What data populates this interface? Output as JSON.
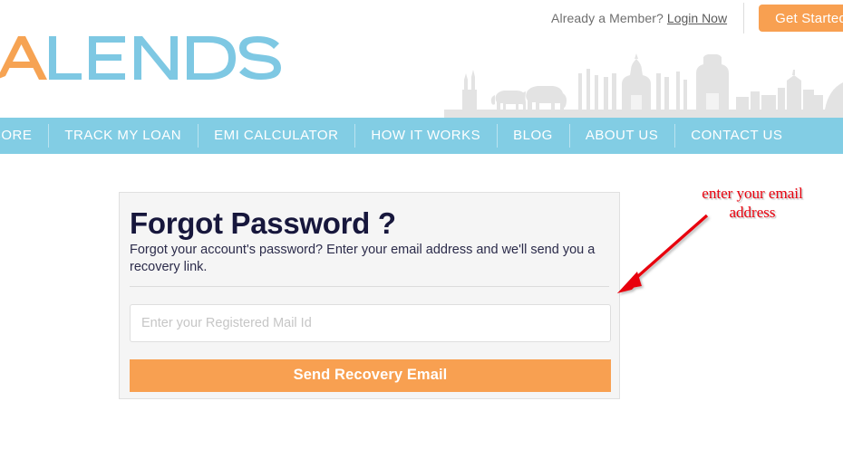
{
  "header": {
    "logo": {
      "text": "ALENDS",
      "accent_letter": "A",
      "accent_color": "#f6a353",
      "brand_color": "#7ec8e3"
    },
    "member_prompt": "Already a Member?",
    "login_link": "Login Now",
    "get_started_label": "Get Started",
    "skyline_color": "#e3e3e3"
  },
  "nav": {
    "background": "#82cde4",
    "items": [
      {
        "label": "CORE"
      },
      {
        "label": "TRACK MY LOAN"
      },
      {
        "label": "EMI CALCULATOR"
      },
      {
        "label": "HOW IT WORKS"
      },
      {
        "label": "BLOG"
      },
      {
        "label": "ABOUT US"
      },
      {
        "label": "CONTACT US"
      }
    ]
  },
  "card": {
    "title": "Forgot Password ?",
    "subtitle": "Forgot your account's password? Enter your email address and we'll send you a recovery link.",
    "email_placeholder": "Enter your Registered Mail Id",
    "email_value": "",
    "submit_label": "Send Recovery Email",
    "background": "#f5f5f5",
    "submit_color": "#f8a051"
  },
  "annotation": {
    "text": "enter your email\naddress",
    "color": "#e8000d"
  }
}
